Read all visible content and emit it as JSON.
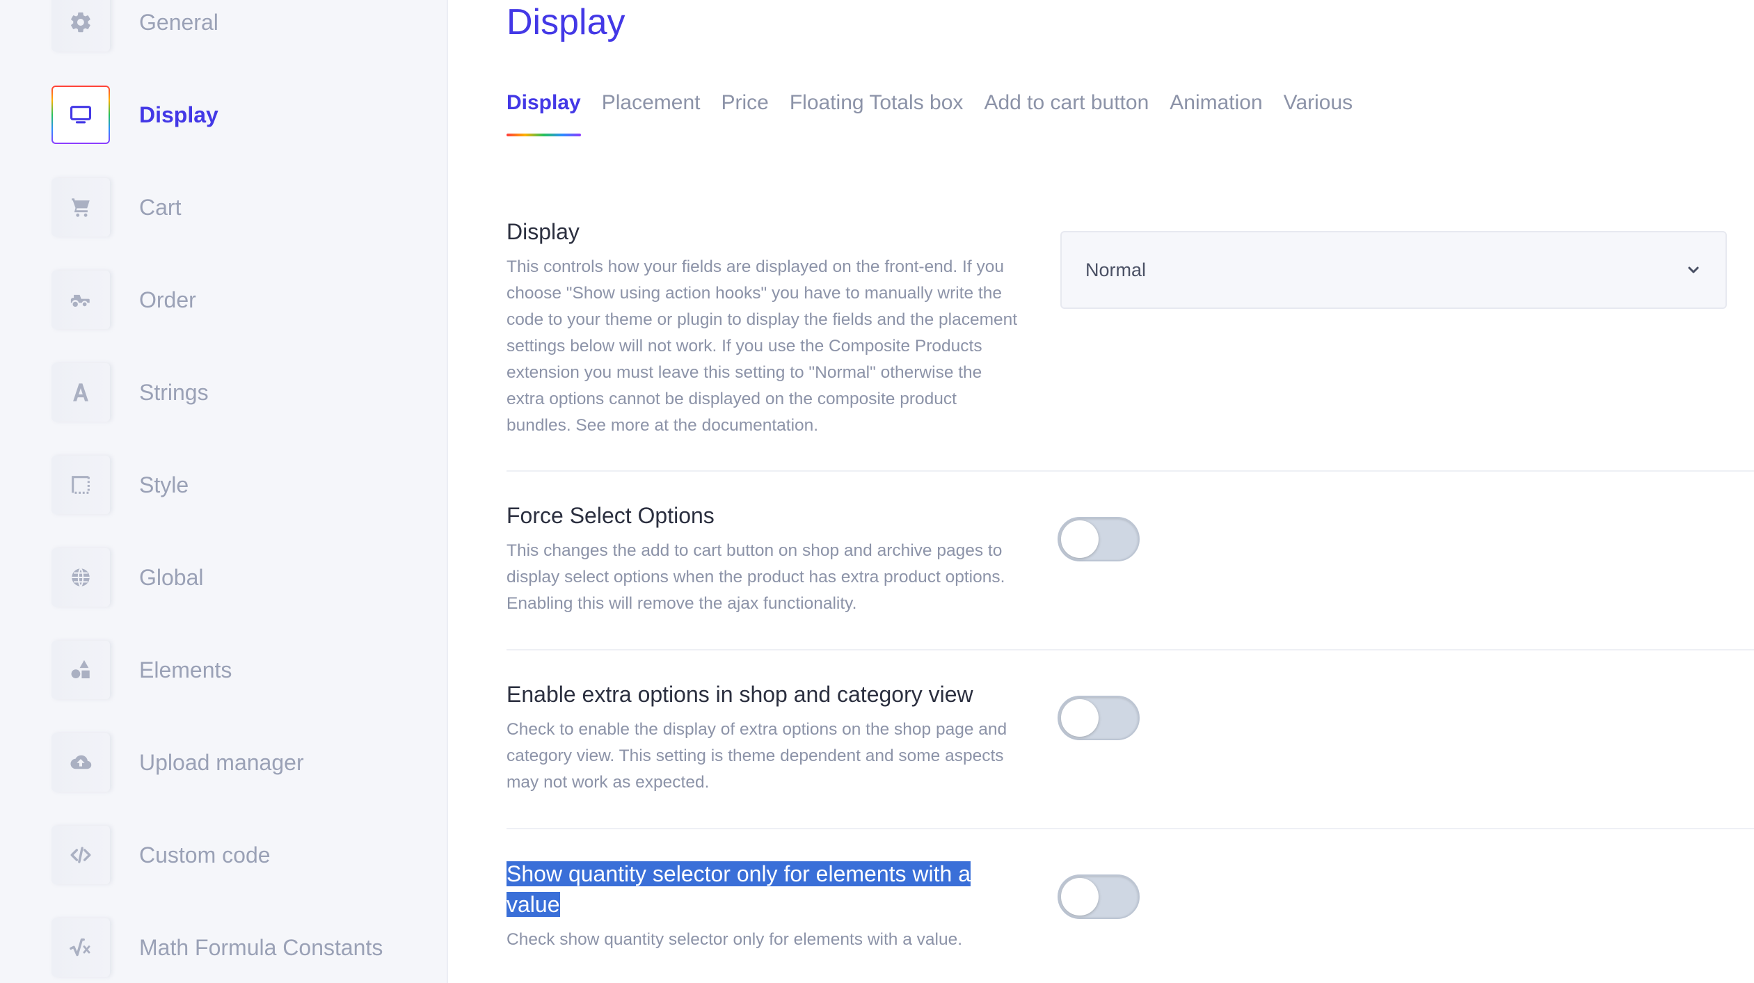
{
  "sidebar": {
    "items": [
      {
        "label": "General",
        "icon": "gear-icon"
      },
      {
        "label": "Display",
        "icon": "monitor-icon",
        "active": true
      },
      {
        "label": "Cart",
        "icon": "cart-icon"
      },
      {
        "label": "Order",
        "icon": "tractor-icon"
      },
      {
        "label": "Strings",
        "icon": "letter-a-icon"
      },
      {
        "label": "Style",
        "icon": "style-frame-icon"
      },
      {
        "label": "Global",
        "icon": "globe-icon"
      },
      {
        "label": "Elements",
        "icon": "shapes-icon"
      },
      {
        "label": "Upload manager",
        "icon": "cloud-upload-icon"
      },
      {
        "label": "Custom code",
        "icon": "code-icon"
      },
      {
        "label": "Math Formula Constants",
        "icon": "square-root-icon"
      }
    ]
  },
  "main": {
    "title": "Display",
    "tabs": [
      {
        "label": "Display",
        "active": true
      },
      {
        "label": "Placement"
      },
      {
        "label": "Price"
      },
      {
        "label": "Floating Totals box"
      },
      {
        "label": "Add to cart button"
      },
      {
        "label": "Animation"
      },
      {
        "label": "Various"
      }
    ],
    "settings": {
      "display": {
        "title": "Display",
        "description": "This controls how your fields are displayed on the front-end. If you choose \"Show using action hooks\" you have to manually write the code to your theme or plugin to display the fields and the placement settings below will not work. If you use the Composite Products extension you must leave this setting to \"Normal\" otherwise the extra options cannot be displayed on the composite product bundles. See more at the documentation.",
        "select_value": "Normal"
      },
      "force_select": {
        "title": "Force Select Options",
        "description": "This changes the add to cart button on shop and archive pages to display select options when the product has extra product options. Enabling this will remove the ajax functionality.",
        "enabled": false
      },
      "enable_extra": {
        "title": "Enable extra options in shop and category view",
        "description": "Check to enable the display of extra options on the shop page and category view. This setting is theme dependent and some aspects may not work as expected.",
        "enabled": false
      },
      "show_quantity": {
        "title": "Show quantity selector only for elements with a value",
        "description": "Check show quantity selector only for elements with a value.",
        "enabled": false
      }
    }
  },
  "colors": {
    "accent": "#4338e6",
    "selection": "#3a6fd8"
  }
}
